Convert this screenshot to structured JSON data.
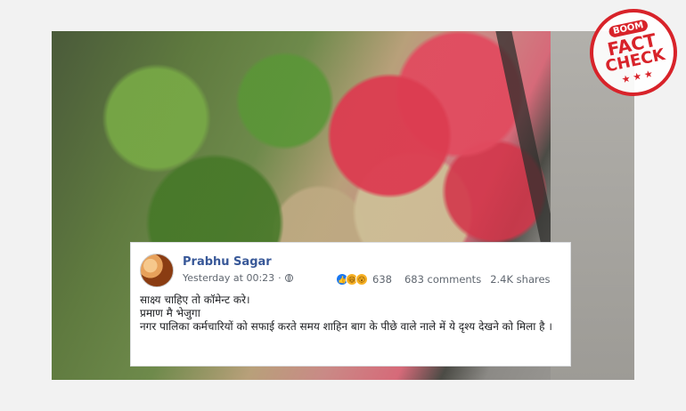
{
  "badge": {
    "top": "BOOM",
    "line1": "FACT",
    "line2": "CHECK",
    "stars": "★★★"
  },
  "post": {
    "author": "Prabhu Sagar",
    "timestamp": "Yesterday at 00:23",
    "reaction_count": "638",
    "comments": "683 comments",
    "shares": "2.4K shares",
    "lines": [
      "साक्ष्य चाहिए तो कॉमेन्ट करे।",
      "प्रमाण मै भेजुगा",
      "नगर पालिका कर्मचारियों को सफाई करते समय शाहिन बाग के पीछे वाले नाले में ये दृश्य देखने को मिला है ।"
    ]
  },
  "icons": {
    "like": "like-reaction-icon",
    "haha": "haha-reaction-icon",
    "wow": "wow-reaction-icon",
    "privacy": "globe-icon"
  },
  "colors": {
    "fb_link": "#385898",
    "meta_text": "#606770",
    "badge_red": "#d8232a"
  }
}
